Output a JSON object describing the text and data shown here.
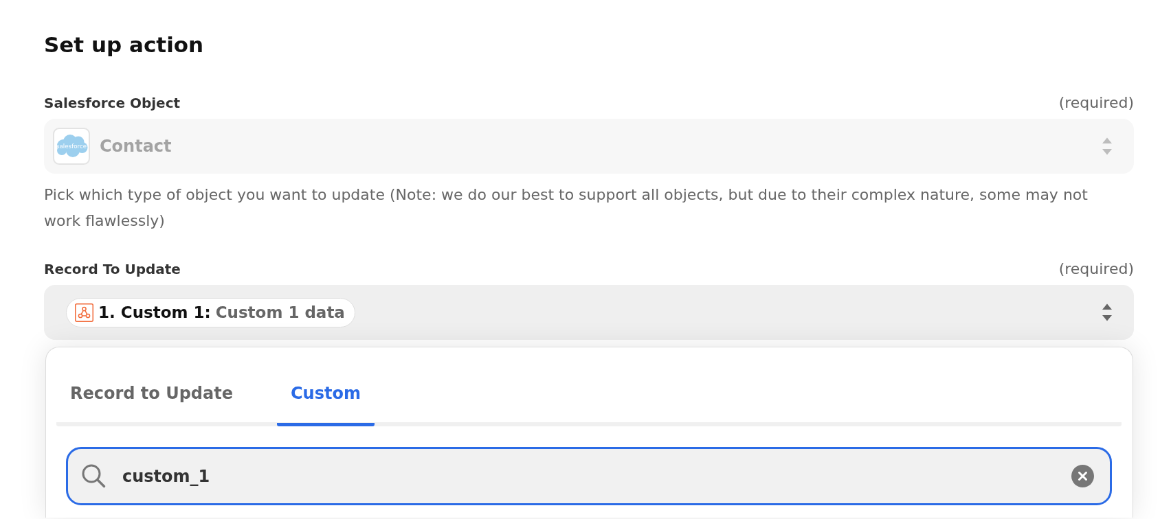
{
  "page": {
    "title": "Set up action"
  },
  "fields": [
    {
      "kind": "select",
      "label": "Salesforce Object",
      "requirement": "(required)",
      "disabled": true,
      "logo_text": "salesforce",
      "value": "Contact",
      "help": "Pick which type of object you want to update (Note: we do our best to support all objects, but due to their complex nature, some may not work flawlessly)"
    },
    {
      "kind": "select",
      "label": "Record To Update",
      "requirement": "(required)",
      "disabled": false,
      "token": {
        "step": "1. Custom 1:",
        "value": "Custom 1 data"
      }
    }
  ],
  "dropdown": {
    "tabs": [
      {
        "label": "Record to Update",
        "selected": false
      },
      {
        "label": "Custom",
        "selected": true
      }
    ],
    "search": {
      "value": "custom_1"
    }
  }
}
